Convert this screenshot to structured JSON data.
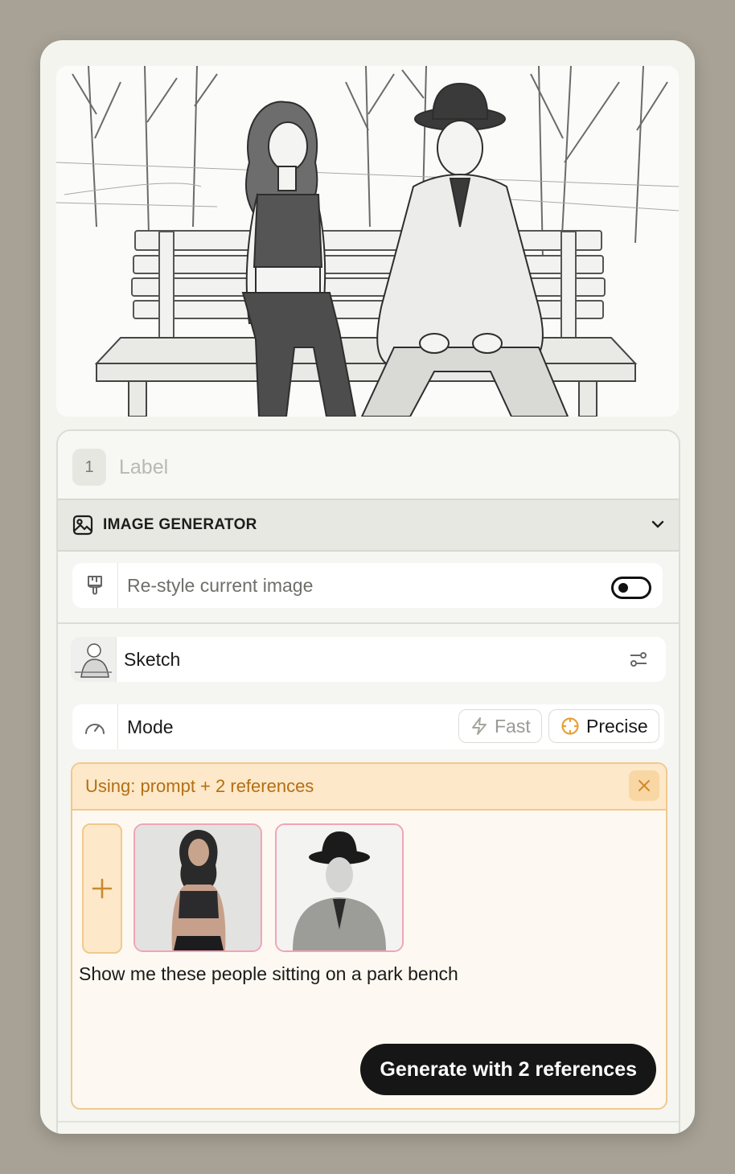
{
  "node": {
    "number": "1",
    "label_placeholder": "Label"
  },
  "section": {
    "title": "IMAGE GENERATOR"
  },
  "restyle": {
    "label": "Re-style current image",
    "enabled": false
  },
  "style": {
    "name": "Sketch"
  },
  "mode": {
    "label": "Mode",
    "options": [
      "Fast",
      "Precise"
    ],
    "selected": "Precise"
  },
  "references": {
    "header": "Using: prompt + 2 references",
    "prompt": "Show me these people sitting on a park bench",
    "generate_label": "Generate with 2 references"
  },
  "colors": {
    "accent_orange": "#e8a13a",
    "ref_border_pink": "#f0a4b8",
    "button_dark": "#161616"
  }
}
